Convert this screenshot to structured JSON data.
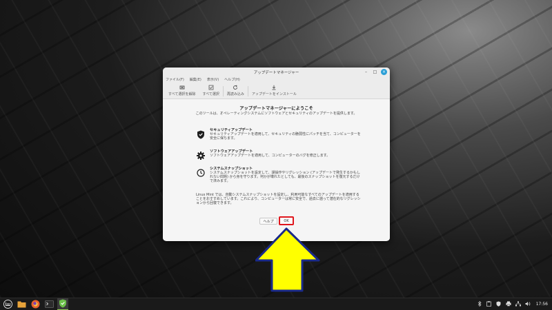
{
  "window": {
    "title": "アップデートマネージャー",
    "controls": {
      "minimize": "–",
      "maximize": "□",
      "close": "×"
    }
  },
  "menubar": {
    "items": [
      "ファイル(F)",
      "編集(E)",
      "表示(V)",
      "ヘルプ(H)"
    ]
  },
  "toolbar": {
    "items": [
      {
        "label": "すべて選択を解除",
        "icon": "deselect-icon"
      },
      {
        "label": "すべて選択",
        "icon": "select-all-icon"
      },
      {
        "label": "再読み込み",
        "icon": "refresh-icon"
      },
      {
        "label": "アップデートをインストール",
        "icon": "download-icon"
      }
    ]
  },
  "welcome": {
    "title": "アップデートマネージャーにようこそ",
    "description": "このツールは、オペレーティングシステムにソフトウェアとセキュリティのアップデートを提供します。"
  },
  "features": [
    {
      "title": "セキュリティアップデート",
      "description": "セキュリティアップデートを適用して、セキュリティの脆弱性にパッチを当て、コンピューターを安全に保ちます。",
      "icon": "shield-icon"
    },
    {
      "title": "ソフトウェアアップデート",
      "description": "ソフトウェアアップデートを適用して、コンピューターのバグを修正します。",
      "icon": "gear-icon"
    },
    {
      "title": "システムスナップショット",
      "description": "システムスナップショットを設定して、誤操作やリグレッション (アップデートで発生するかもしれない問題) から身を守ります。何かが壊れたとしても、最後のスナップショットを復元するだけで済みます。",
      "icon": "clock-icon"
    }
  ],
  "note": "Linux Mint では、自動システムスナップショットを設定し、利用可能なすべてのアップデートを適用することをおすすめしています。これにより、コンピューターは常に安全で、過去に遡って潜在的なリグレッションから回復できます。",
  "buttons": {
    "help": "ヘルプ",
    "ok": "OK"
  },
  "taskbar": {
    "apps": [
      "mint-menu-icon",
      "files-icon",
      "firefox-icon",
      "terminal-icon",
      "update-manager-icon"
    ],
    "tray": [
      "bluetooth-icon",
      "clipboard-icon",
      "update-tray-icon",
      "printer-icon",
      "network-icon",
      "volume-icon"
    ],
    "clock": "17:56"
  },
  "colors": {
    "highlight": "#e0161c",
    "arrow_fill": "#ffff00",
    "arrow_stroke": "#1a2a8a",
    "close_button": "#2a9fd6",
    "active_app": "#8fd14f"
  }
}
